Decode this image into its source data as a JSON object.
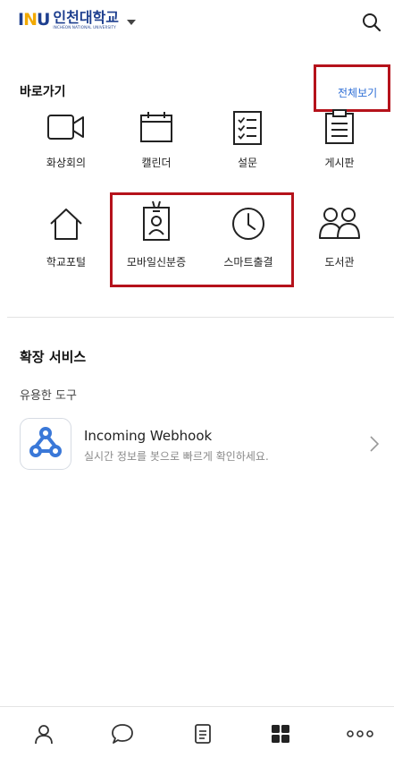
{
  "header": {
    "logo_mark": "INU",
    "logo_title": "인천대학교",
    "logo_subtitle": "INCHEON NATIONAL UNIVERSITY"
  },
  "shortcuts": {
    "title": "바로가기",
    "view_all": "전체보기",
    "items": [
      {
        "label": "화상회의",
        "icon": "video-camera-icon"
      },
      {
        "label": "캘린더",
        "icon": "calendar-icon"
      },
      {
        "label": "설문",
        "icon": "checklist-icon"
      },
      {
        "label": "게시판",
        "icon": "clipboard-icon"
      },
      {
        "label": "학교포털",
        "icon": "home-icon"
      },
      {
        "label": "모바일신분증",
        "icon": "id-badge-icon"
      },
      {
        "label": "스마트출결",
        "icon": "clock-icon"
      },
      {
        "label": "도서관",
        "icon": "people-icon"
      }
    ]
  },
  "extensions": {
    "title": "확장 서비스",
    "subtitle": "유용한 도구",
    "items": [
      {
        "name": "Incoming Webhook",
        "desc": "실시간 정보를 봇으로 빠르게 확인하세요.",
        "icon": "webhook-icon"
      }
    ]
  },
  "tabbar": {
    "items": [
      {
        "icon": "person-icon",
        "active": false
      },
      {
        "icon": "chat-bubble-icon",
        "active": false
      },
      {
        "icon": "document-icon",
        "active": false
      },
      {
        "icon": "grid-icon",
        "active": true
      },
      {
        "icon": "more-icon",
        "active": false
      }
    ]
  },
  "colors": {
    "brand": "#1e3f8f",
    "logo_accent": "#f2a900",
    "link": "#2f6fd6",
    "highlight_box": "#b5121b",
    "webhook": "#3a78d8"
  }
}
